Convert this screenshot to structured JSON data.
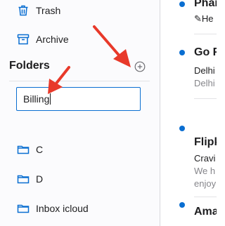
{
  "sidebar": {
    "trash_label": "Trash",
    "archive_label": "Archive",
    "folders_title": "Folders",
    "new_folder_value": "Billing",
    "folders": [
      {
        "label": "C"
      },
      {
        "label": "D"
      },
      {
        "label": "Inbox icloud"
      }
    ]
  },
  "messages": [
    {
      "sender": "Phar",
      "subject": "✎He"
    },
    {
      "sender": "Go F",
      "subject": "Delhi",
      "preview": "Delhi"
    },
    {
      "sender": "Flipk",
      "subject": "Cravi",
      "preview": "We h",
      "preview2": "enjoy"
    },
    {
      "sender": "Ama"
    }
  ],
  "colors": {
    "accent": "#0a6ed1",
    "annotation_arrow": "#e8392a"
  }
}
